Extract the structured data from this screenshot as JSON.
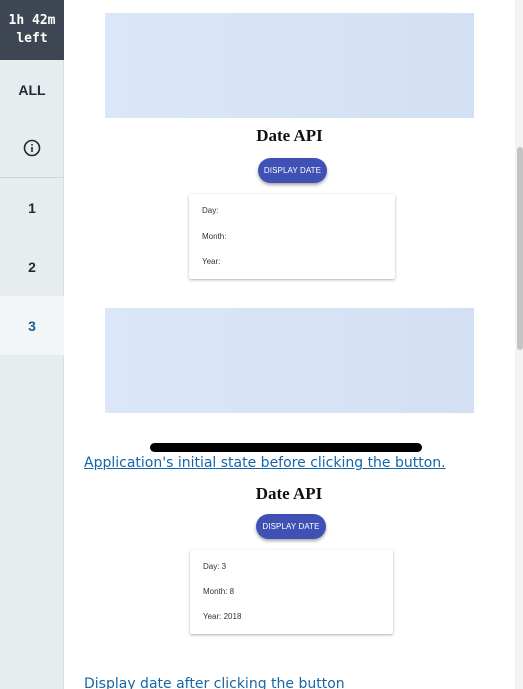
{
  "sidebar": {
    "timer_line1": "1h 42m",
    "timer_line2": "left",
    "items": [
      {
        "label": "ALL"
      },
      {
        "label": ""
      },
      {
        "label": "1"
      },
      {
        "label": "2"
      },
      {
        "label": "3"
      }
    ],
    "active_item": "3"
  },
  "figure1": {
    "title": "Date API",
    "button_label": "DISPLAY DATE",
    "day_label": "Day:",
    "month_label": "Month:",
    "year_label": "Year:",
    "caption": "Application's initial state before clicking the button."
  },
  "figure2": {
    "title": "Date API",
    "button_label": "DISPLAY DATE",
    "day_label": "Day: 3",
    "month_label": "Month: 8",
    "year_label": "Year: 2018",
    "caption": "Display date after clicking the button"
  },
  "colors": {
    "button": "#3f51b5",
    "link": "#1565a8",
    "sidebar": "#e7ecef",
    "timer_bg": "#3e4653",
    "active_item_text": "#1a5f8a"
  }
}
